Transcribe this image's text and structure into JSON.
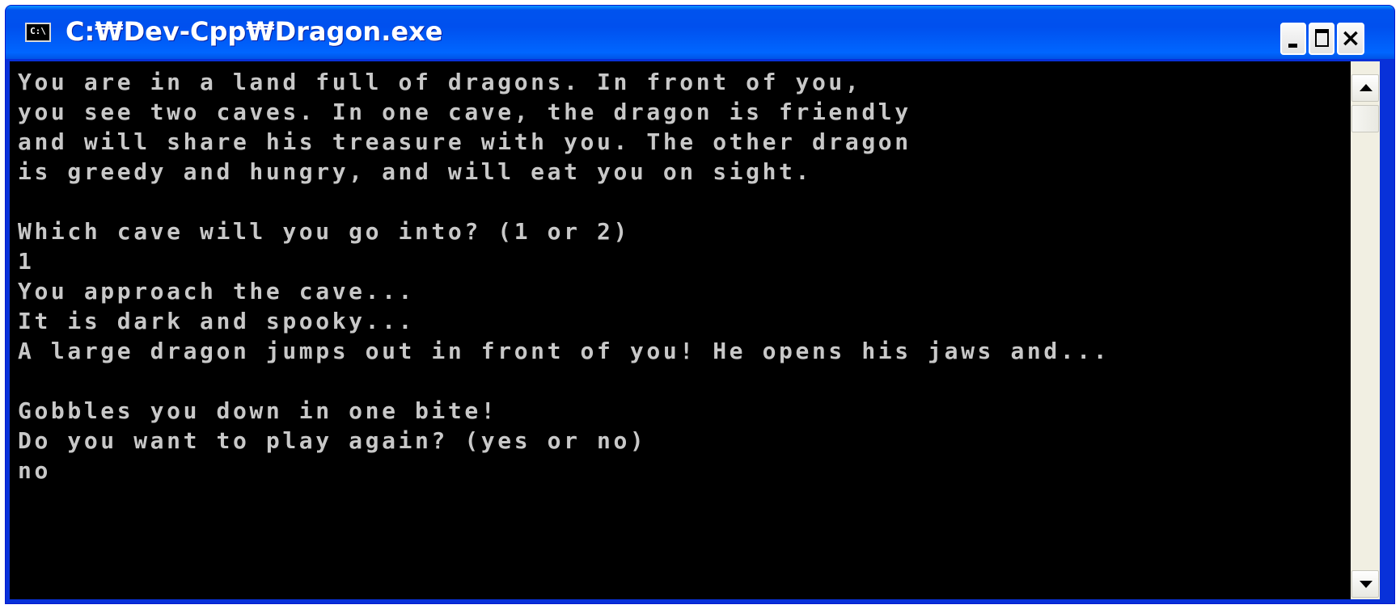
{
  "window": {
    "title": "C:₩Dev-Cpp₩Dragon.exe",
    "icon_label": "C:\\",
    "icon_name": "console-app-icon",
    "controls": {
      "minimize": "minimize-icon",
      "maximize": "maximize-icon",
      "close": "close-icon",
      "close_glyph": "×"
    }
  },
  "console": {
    "lines": [
      "You are in a land full of dragons. In front of you,",
      "you see two caves. In one cave, the dragon is friendly",
      "and will share his treasure with you. The other dragon",
      "is greedy and hungry, and will eat you on sight.",
      "",
      "Which cave will you go into? (1 or 2)",
      "1",
      "You approach the cave...",
      "It is dark and spooky...",
      "A large dragon jumps out in front of you! He opens his jaws and...",
      "",
      "Gobbles you down in one bite!",
      "Do you want to play again? (yes or no)",
      "no"
    ]
  },
  "scrollbar": {
    "up": "scroll-up-arrow-icon",
    "down": "scroll-down-arrow-icon"
  },
  "colors": {
    "titlebar": "#0054e3",
    "console_bg": "#000000",
    "console_fg": "#c0c0c0"
  }
}
